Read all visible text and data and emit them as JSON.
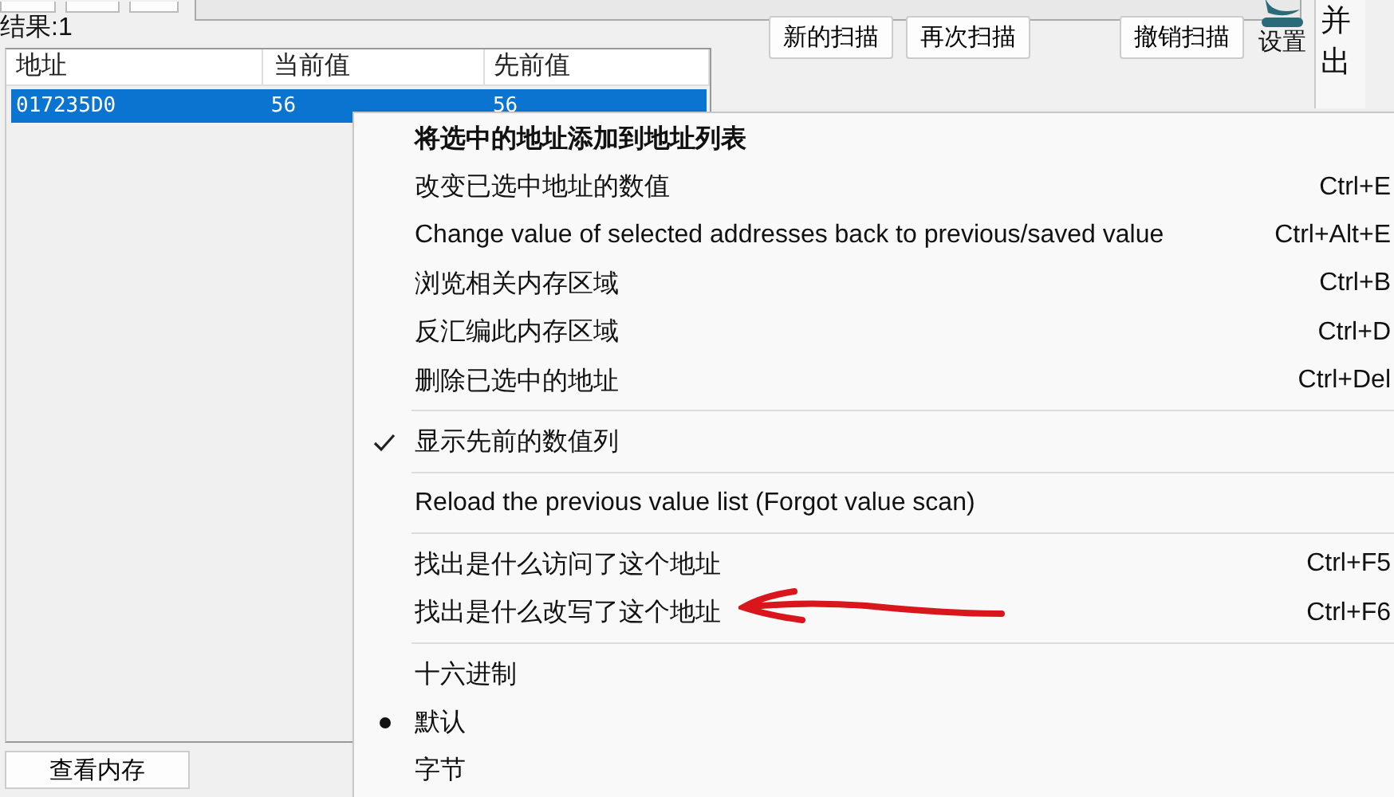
{
  "result_label": "结果:1",
  "table": {
    "columns": [
      "地址",
      "当前值",
      "先前值"
    ],
    "rows": [
      {
        "cells": [
          "017235D0",
          "56",
          "56"
        ],
        "selected": true
      }
    ]
  },
  "scan_buttons": [
    "新的扫描",
    "再次扫描",
    "撤销扫描"
  ],
  "settings": {
    "label": "设置"
  },
  "side_text": [
    "并",
    "出"
  ],
  "view_memory_button": "查看内存",
  "menu": {
    "items": [
      {
        "kind": "command",
        "label": "将选中的地址添加到地址列表",
        "bold": true
      },
      {
        "kind": "command",
        "label": "改变已选中地址的数值",
        "shortcut": "Ctrl+E",
        "bold": false
      },
      {
        "kind": "command",
        "label": "Change value of selected addresses back to previous/saved value",
        "shortcut": "Ctrl+Alt+E",
        "bold": false
      },
      {
        "kind": "command",
        "label": "浏览相关内存区域",
        "shortcut": "Ctrl+B",
        "bold": false
      },
      {
        "kind": "command",
        "label": "反汇编此内存区域",
        "shortcut": "Ctrl+D",
        "bold": false
      },
      {
        "kind": "command",
        "label": "删除已选中的地址",
        "shortcut": "Ctrl+Del",
        "bold": false
      },
      {
        "kind": "separator"
      },
      {
        "kind": "check",
        "label": "显示先前的数值列",
        "checked": true
      },
      {
        "kind": "separator"
      },
      {
        "kind": "command",
        "label": "Reload the previous value list (Forgot value scan)",
        "bold": false
      },
      {
        "kind": "separator"
      },
      {
        "kind": "command",
        "label": "找出是什么访问了这个地址",
        "shortcut": "Ctrl+F5",
        "bold": false
      },
      {
        "kind": "command",
        "label": "找出是什么改写了这个地址",
        "shortcut": "Ctrl+F6",
        "bold": false
      },
      {
        "kind": "separator"
      },
      {
        "kind": "radio",
        "label": "十六进制",
        "selected": false
      },
      {
        "kind": "radio",
        "label": "默认",
        "selected": true
      },
      {
        "kind": "radio",
        "label": "字节",
        "selected": false
      }
    ]
  }
}
